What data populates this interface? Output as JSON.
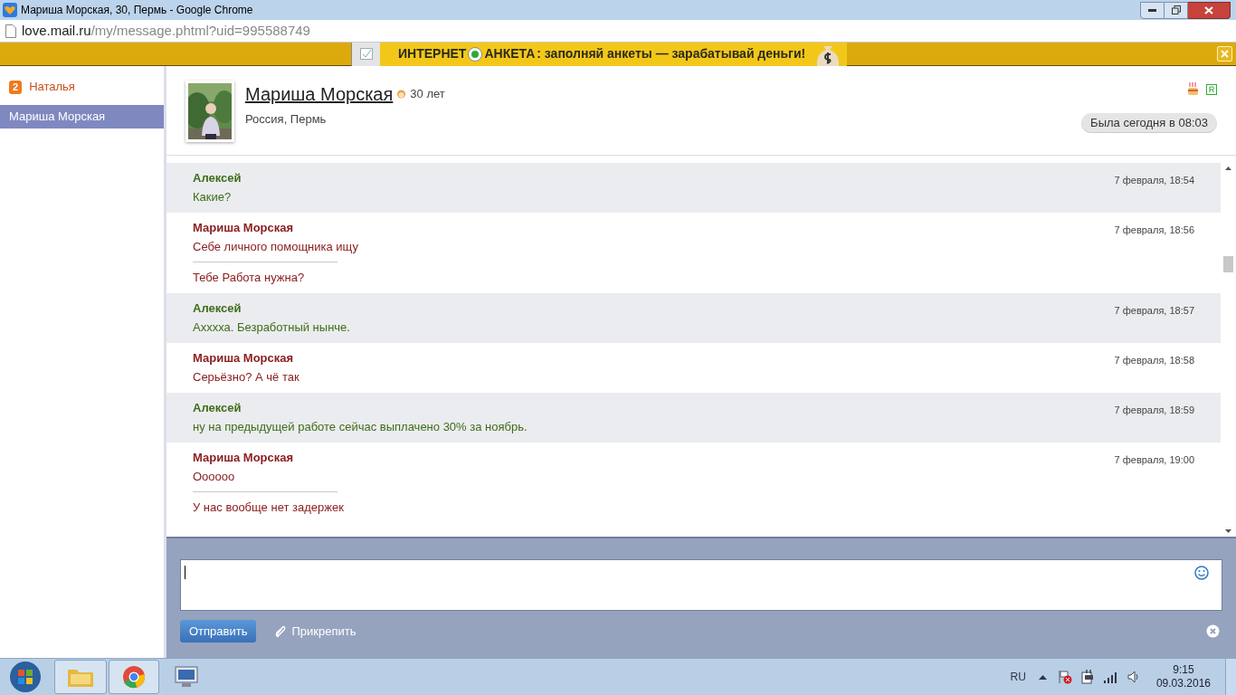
{
  "window": {
    "title": "Мариша Морская, 30, Пермь - Google Chrome"
  },
  "address_bar": {
    "host": "love.mail.ru",
    "path": "/my/message.phtml?uid=995588749"
  },
  "banner": {
    "brand_left": "ИНТЕРНЕТ",
    "brand_right": "АНКЕТА",
    "text": ": заполняй анкеты — зарабатывай деньги!"
  },
  "sidebar": {
    "items": [
      {
        "name": "Наталья",
        "badge": "2",
        "selected": false
      },
      {
        "name": "Мариша Морская",
        "selected": true
      }
    ]
  },
  "profile": {
    "name": "Мариша Морская",
    "age": "30 лет",
    "location": "Россия, Пермь",
    "last_seen": "Была сегодня в 08:03"
  },
  "messages": [
    {
      "kind": "theirs",
      "author": "Алексей",
      "time": "7 февраля, 18:54",
      "lines": [
        "Какие?"
      ]
    },
    {
      "kind": "mine",
      "author": "Мариша Морская",
      "time": "7 февраля, 18:56",
      "lines": [
        "Себе личного помощника ищу",
        "Тебе Работа нужна?"
      ]
    },
    {
      "kind": "theirs",
      "author": "Алексей",
      "time": "7 февраля, 18:57",
      "lines": [
        "Ахххха. Безработный нынче."
      ]
    },
    {
      "kind": "mine",
      "author": "Мариша Морская",
      "time": "7 февраля, 18:58",
      "lines": [
        "Серьёзно? А чё так"
      ]
    },
    {
      "kind": "theirs",
      "author": "Алексей",
      "time": "7 февраля, 18:59",
      "lines": [
        "ну на предыдущей работе сейчас выплачено 30% за ноябрь."
      ]
    },
    {
      "kind": "mine",
      "author": "Мариша Морская",
      "time": "7 февраля, 19:00",
      "lines": [
        "Оооооо",
        "У нас вообще нет задержек"
      ]
    }
  ],
  "compose": {
    "send": "Отправить",
    "attach": "Прикрепить"
  },
  "taskbar": {
    "language": "RU",
    "time": "9:15",
    "date": "09.03.2016"
  }
}
